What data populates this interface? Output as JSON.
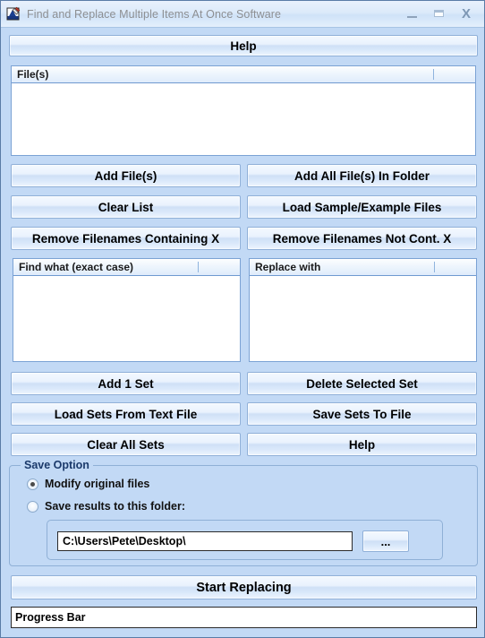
{
  "window": {
    "title": "Find and Replace Multiple Items At Once Software",
    "icon": "app-find-replace-icon",
    "controls": {
      "minimize": "_",
      "maximize": "□",
      "close": "X"
    },
    "background_color": "#c2d9f5",
    "titlebar_text_color": "#8d8f92"
  },
  "top": {
    "help_label": "Help"
  },
  "files_list": {
    "header": "File(s)",
    "rows": []
  },
  "file_buttons": [
    {
      "label": "Add File(s)",
      "name": "add-files-button"
    },
    {
      "label": "Add All File(s) In Folder",
      "name": "add-all-files-in-folder-button"
    },
    {
      "label": "Clear List",
      "name": "clear-list-button"
    },
    {
      "label": "Load Sample/Example Files",
      "name": "load-sample-example-files-button"
    },
    {
      "label": "Remove Filenames Containing X",
      "name": "remove-filenames-containing-x-button"
    },
    {
      "label": "Remove Filenames Not Cont. X",
      "name": "remove-filenames-not-containing-x-button"
    }
  ],
  "find_list": {
    "header": "Find what (exact case)",
    "rows": []
  },
  "replace_list": {
    "header": "Replace with",
    "rows": []
  },
  "set_buttons": [
    {
      "label": "Add 1 Set",
      "name": "add-1-set-button"
    },
    {
      "label": "Delete Selected Set",
      "name": "delete-selected-set-button"
    },
    {
      "label": "Load Sets From Text File",
      "name": "load-sets-from-text-file-button"
    },
    {
      "label": "Save Sets To File",
      "name": "save-sets-to-file-button"
    },
    {
      "label": "Clear All Sets",
      "name": "clear-all-sets-button"
    },
    {
      "label": "Help",
      "name": "help-sets-button"
    }
  ],
  "save_option": {
    "title": "Save Option",
    "title_color": "#1b3a6b",
    "radio_modify": {
      "label": "Modify original files",
      "selected": true
    },
    "radio_folder": {
      "label": "Save results to this folder:",
      "selected": false
    },
    "folder_path": "C:\\Users\\Pete\\Desktop\\",
    "browse_label": "..."
  },
  "bottom": {
    "start_label": "Start Replacing",
    "progress_label": "Progress Bar"
  }
}
